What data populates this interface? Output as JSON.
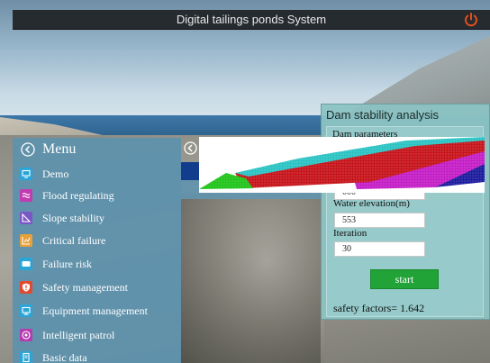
{
  "app": {
    "title": "Digital tailings ponds System"
  },
  "menu": {
    "title": "Menu",
    "items": [
      {
        "label": "Demo",
        "icon": "monitor-icon",
        "color": "#2aa5d8"
      },
      {
        "label": "Flood regulating",
        "icon": "waves-icon",
        "color": "#c23bb0"
      },
      {
        "label": "Slope stability",
        "icon": "slope-icon",
        "color": "#7b57c6"
      },
      {
        "label": "Critical failure",
        "icon": "chart-icon",
        "color": "#e8a03a"
      },
      {
        "label": "Failure risk",
        "icon": "alert-icon",
        "color": "#2aa5d8"
      },
      {
        "label": "Safety management",
        "icon": "shield-icon",
        "color": "#e04a2e"
      },
      {
        "label": "Equipment management",
        "icon": "equipment-icon",
        "color": "#2aa5d8"
      },
      {
        "label": "Intelligent patrol",
        "icon": "patrol-icon",
        "color": "#b43bb0"
      },
      {
        "label": "Basic data",
        "icon": "document-icon",
        "color": "#2aa5d8"
      }
    ]
  },
  "dam": {
    "title": "Dam stability analysis",
    "section": "Dam parameters",
    "fields": [
      {
        "label": "",
        "value": "000"
      },
      {
        "label": "Water elevation(m)",
        "value": "553"
      },
      {
        "label": "Iteration",
        "value": "30"
      }
    ],
    "start_label": "start",
    "result_label": "safety factors=",
    "result_value": "1.642"
  },
  "colors": {
    "accent_green": "#22a338",
    "menu_bg": "#5f92ac",
    "panel_bg": "#8cc3c3",
    "titlebar_bg": "#262b30",
    "power": "#e2501d"
  }
}
